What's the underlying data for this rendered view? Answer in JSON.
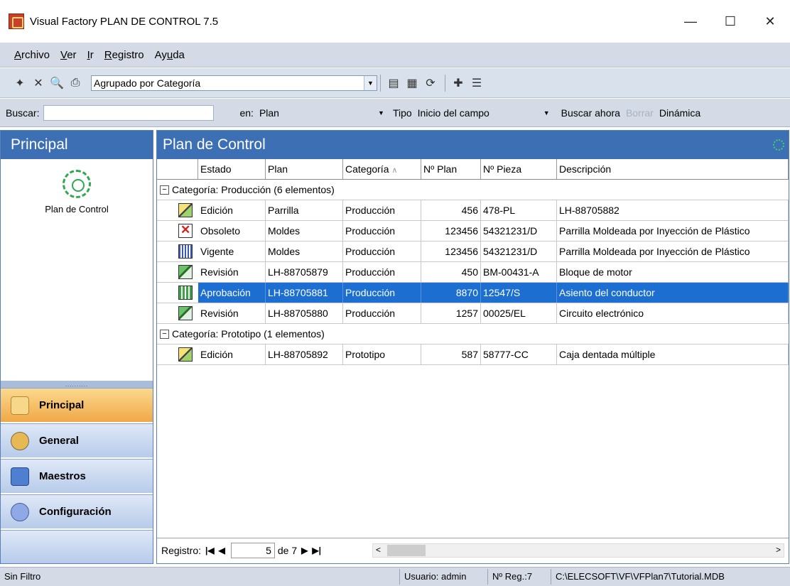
{
  "window": {
    "title": "Visual Factory PLAN DE CONTROL 7.5",
    "minimize": "—",
    "maximize": "☐",
    "close": "✕"
  },
  "menu": [
    {
      "label": "Archivo",
      "accel": "A",
      "rest": "rchivo"
    },
    {
      "label": "Ver",
      "accel": "V",
      "rest": "er"
    },
    {
      "label": "Ir",
      "accel": "I",
      "rest": "r"
    },
    {
      "label": "Registro",
      "accel": "R",
      "rest": "egistro"
    },
    {
      "label": "Ayuda",
      "pre": "Ay",
      "accel": "u",
      "rest": "da"
    }
  ],
  "toolbar": {
    "grouping": "Agrupado por Categoría"
  },
  "search": {
    "label": "Buscar:",
    "value": "",
    "in_label": "en:",
    "in_value": "Plan",
    "tipo_label": "Tipo",
    "tipo_value": "Inicio del campo",
    "search_now": "Buscar ahora",
    "clear": "Borrar",
    "dynamic": "Dinámica"
  },
  "left_panel": {
    "header": "Principal",
    "item_label": "Plan de Control",
    "splitter": "..........",
    "nav": [
      {
        "label": "Principal",
        "active": true
      },
      {
        "label": "General",
        "active": false
      },
      {
        "label": "Maestros",
        "active": false
      },
      {
        "label": "Configuración",
        "active": false
      }
    ]
  },
  "right_panel": {
    "header": "Plan de Control",
    "columns": [
      "Estado",
      "Plan",
      "Categoría",
      "Nº Plan",
      "Nº Pieza",
      "Descripción"
    ],
    "sort_indicator": "∧",
    "groups": [
      {
        "label": "Categoría:  Producción (6 elementos)",
        "rows": [
          {
            "estado": "Edición",
            "plan": "Parrilla",
            "categoria": "Producción",
            "nplan": "456",
            "npieza": "478-PL",
            "descripcion": "LH-88705882",
            "icon": "edit"
          },
          {
            "estado": "Obsoleto",
            "plan": "Moldes",
            "categoria": "Producción",
            "nplan": "123456",
            "npieza": "54321231/D",
            "descripcion": "Parrilla Moldeada por Inyección de Plástico",
            "icon": "obs"
          },
          {
            "estado": "Vigente",
            "plan": "Moldes",
            "categoria": "Producción",
            "nplan": "123456",
            "npieza": "54321231/D",
            "descripcion": "Parrilla Moldeada por Inyección de Plástico",
            "icon": "vig"
          },
          {
            "estado": "Revisión",
            "plan": "LH-88705879",
            "categoria": "Producción",
            "nplan": "450",
            "npieza": "BM-00431-A",
            "descripcion": "Bloque de motor",
            "icon": "rev"
          },
          {
            "estado": "Aprobación",
            "plan": "LH-88705881",
            "categoria": "Producción",
            "nplan": "8870",
            "npieza": "12547/S",
            "descripcion": "Asiento del conductor",
            "icon": "apr",
            "selected": true
          },
          {
            "estado": "Revisión",
            "plan": "LH-88705880",
            "categoria": "Producción",
            "nplan": "1257",
            "npieza": "00025/EL",
            "descripcion": "Circuito electrónico",
            "icon": "rev"
          }
        ]
      },
      {
        "label": "Categoría:  Prototipo (1 elementos)",
        "rows": [
          {
            "estado": "Edición",
            "plan": "LH-88705892",
            "categoria": "Prototipo",
            "nplan": "587",
            "npieza": "58777-CC",
            "descripcion": "Caja dentada múltiple",
            "icon": "edit"
          }
        ]
      }
    ],
    "navigator": {
      "label": "Registro:",
      "current": "5",
      "of": "de 7"
    }
  },
  "status": {
    "filter": "Sin Filtro",
    "user": "Usuario: admin",
    "count": "Nº Reg.:7",
    "path": "C:\\ELECSOFT\\VF\\VFPlan7\\Tutorial.MDB"
  },
  "colors": {
    "header_blue": "#3d6fb5",
    "selected_row": "#1c6fd0",
    "active_nav": "#f0a848"
  }
}
